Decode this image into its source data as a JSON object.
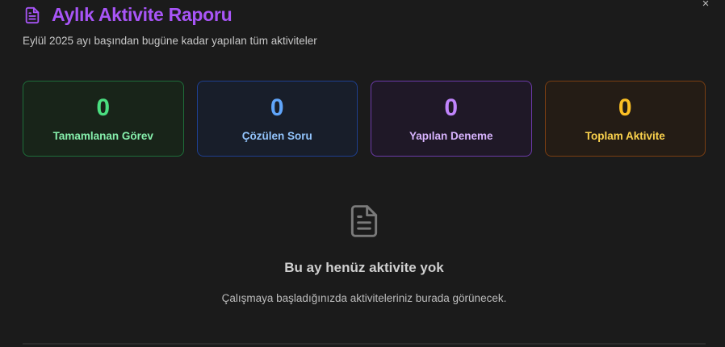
{
  "modal": {
    "title": "Aylık Aktivite Raporu",
    "subtitle": "Eylül 2025 ayı başından bugüne kadar yapılan tüm aktiviteler",
    "close_label": "×",
    "header_icon": "document-icon",
    "accent_color": "#a855f7"
  },
  "stats": [
    {
      "value": "0",
      "label": "Tamamlanan Görev",
      "color": "#4ade80"
    },
    {
      "value": "0",
      "label": "Çözülen Soru",
      "color": "#60a5fa"
    },
    {
      "value": "0",
      "label": "Yapılan Deneme",
      "color": "#c084fc"
    },
    {
      "value": "0",
      "label": "Toplam Aktivite",
      "color": "#fbbf24"
    }
  ],
  "empty_state": {
    "icon": "document-icon",
    "title": "Bu ay henüz aktivite yok",
    "description": "Çalışmaya başladığınızda aktiviteleriniz burada görünecek."
  }
}
